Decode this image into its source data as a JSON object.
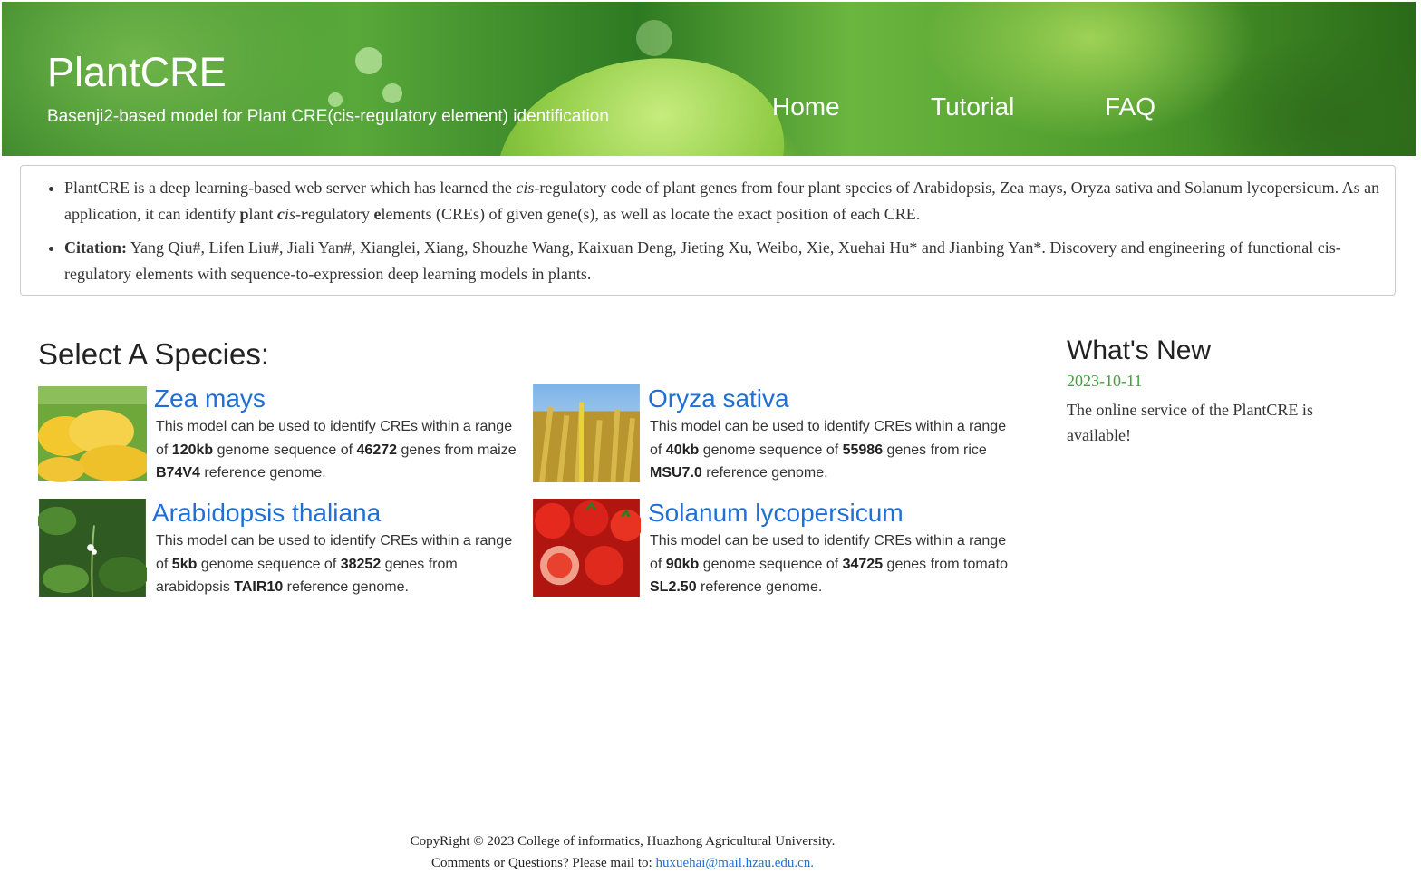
{
  "header": {
    "title": "PlantCRE",
    "subtitle": "Basenji2-based model for Plant CRE(cis-regulatory element) identification",
    "nav": [
      "Home",
      "Tutorial",
      "FAQ"
    ]
  },
  "intro": {
    "p1_a": "PlantCRE is a deep learning-based web server which has learned the ",
    "p1_b": "cis",
    "p1_c": "-regulatory code of plant genes from four plant species of Arabidopsis, Zea mays, Oryza sativa and Solanum lycopersicum. As an application, it can identify ",
    "p1_d": "p",
    "p1_e": "lant ",
    "p1_f": "c",
    "p1_g": "is",
    "p1_h": "-",
    "p1_i": "r",
    "p1_j": "egulatory ",
    "p1_k": "e",
    "p1_l": "lements (CREs) of given gene(s), as well as locate the exact position of each CRE.",
    "citation_label": "Citation:",
    "citation_text": " Yang Qiu#, Lifen Liu#, Jiali Yan#, Xianglei, Xiang, Shouzhe Wang, Kaixuan Deng, Jieting Xu, Weibo, Xie, Xuehai Hu* and Jianbing Yan*. Discovery and engineering of functional cis-regulatory elements with sequence-to-expression deep learning models in plants."
  },
  "species": {
    "title": "Select A Species:",
    "prefix": "This model can be used to identify CREs within a range of ",
    "mid": " genome sequence of ",
    "genes": " genes from ",
    "suffix": " reference genome.",
    "items": [
      {
        "name": "Zea mays",
        "range": "120kb",
        "count": "46272",
        "organism": "maize ",
        "genome": "B74V4"
      },
      {
        "name": "Oryza sativa",
        "range": "40kb",
        "count": "55986",
        "organism": "rice ",
        "genome": "MSU7.0"
      },
      {
        "name": "Arabidopsis thaliana",
        "range": "5kb",
        "count": "38252",
        "organism": "arabidopsis ",
        "genome": "TAIR10"
      },
      {
        "name": "Solanum lycopersicum",
        "range": "90kb",
        "count": "34725",
        "organism": "tomato ",
        "genome": "SL2.50"
      }
    ]
  },
  "news": {
    "title": "What's New",
    "date": "2023-10-11",
    "text": "The online service of the PlantCRE is available!"
  },
  "footer": {
    "copyright": "CopyRight © 2023 College of informatics, Huazhong Agricultural University.",
    "contact": "Comments or Questions? Please mail to: ",
    "email": "huxuehai@mail.hzau.edu.cn."
  },
  "colors": {
    "link": "#1f6fd6",
    "date": "#3aa33a"
  }
}
